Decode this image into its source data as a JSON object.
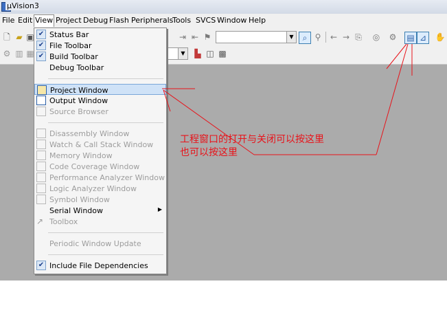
{
  "window": {
    "title": "μVision3"
  },
  "menubar": {
    "items": [
      "File",
      "Edit",
      "View",
      "Project",
      "Debug",
      "Flash",
      "Peripherals",
      "Tools",
      "SVCS",
      "Window",
      "Help"
    ]
  },
  "view_menu": {
    "items": [
      {
        "label": "Status Bar",
        "checked": true
      },
      {
        "label": "File Toolbar",
        "checked": true
      },
      {
        "label": "Build Toolbar",
        "checked": true
      },
      {
        "label": "Debug Toolbar",
        "checked": false
      },
      {
        "label": "Project Window",
        "selected": true
      },
      {
        "label": "Output Window"
      },
      {
        "label": "Source Browser",
        "disabled": true
      },
      {
        "label": "Disassembly Window",
        "disabled": true
      },
      {
        "label": "Watch & Call Stack Window",
        "disabled": true
      },
      {
        "label": "Memory Window",
        "disabled": true
      },
      {
        "label": "Code Coverage Window",
        "disabled": true
      },
      {
        "label": "Performance Analyzer Window",
        "disabled": true
      },
      {
        "label": "Logic Analyzer Window",
        "disabled": true
      },
      {
        "label": "Symbol Window",
        "disabled": true
      },
      {
        "label": "Serial Window",
        "submenu": true
      },
      {
        "label": "Toolbox",
        "disabled": true
      },
      {
        "label": "Periodic Window Update",
        "disabled": true
      },
      {
        "label": "Include File Dependencies",
        "checked": true
      }
    ]
  },
  "annotation": {
    "line1": "工程窗口的打开与关闭可以按这里",
    "line2": "也可以按这里",
    "color": "#e8131a"
  }
}
